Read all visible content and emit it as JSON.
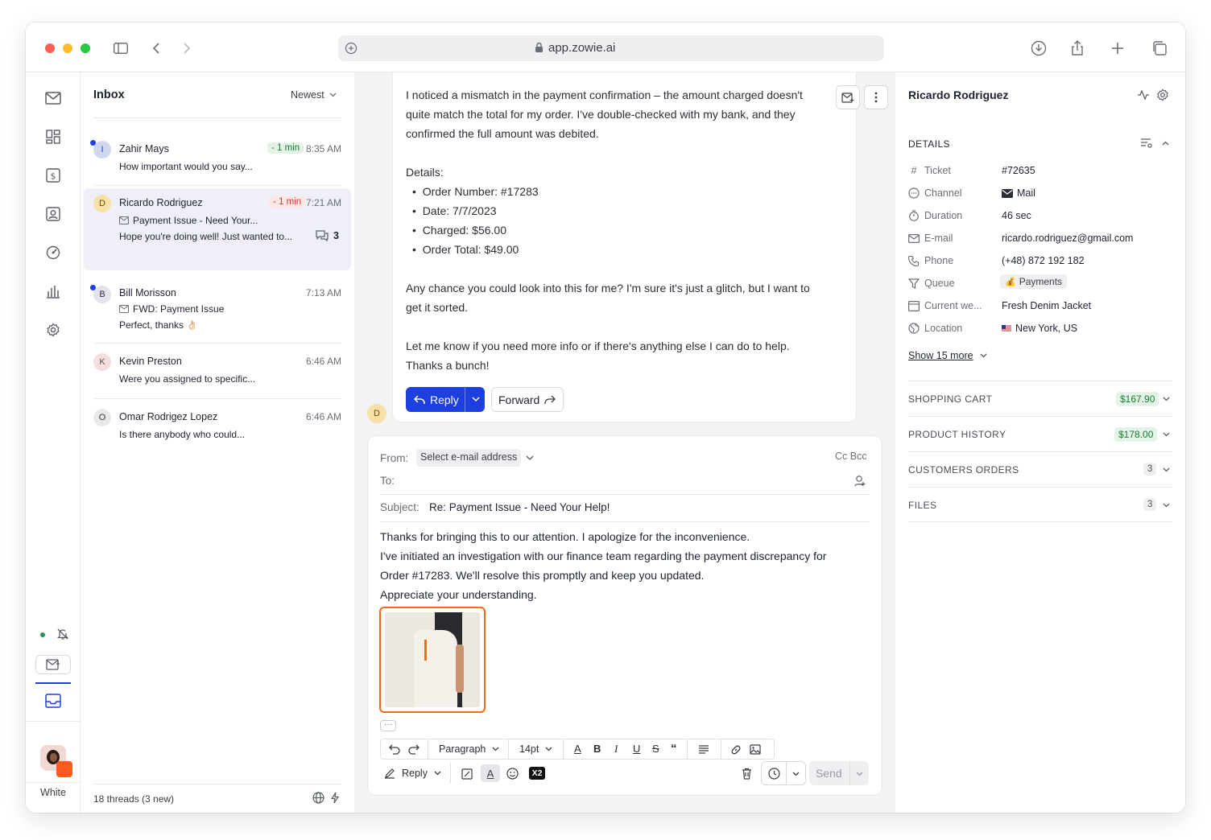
{
  "browser": {
    "url": "app.zowie.ai"
  },
  "inbox": {
    "title": "Inbox",
    "sort_label": "Newest",
    "threads": [
      {
        "initial": "I",
        "name": "Zahir Mays",
        "badge": "- 1 min",
        "time": "8:35 AM",
        "preview": "How important would you say...",
        "unread": true
      },
      {
        "initial": "D",
        "name": "Ricardo Rodriguez",
        "badge": "- 1 min",
        "time": "7:21 AM",
        "subject": "Payment Issue - Need Your...",
        "preview": "Hope you're doing well! Just wanted to...",
        "count": "3",
        "selected": true
      },
      {
        "initial": "B",
        "name": "Bill Morisson",
        "time": "7:13 AM",
        "subject": "FWD: Payment Issue",
        "preview": "Perfect, thanks 👌🏻",
        "unread": true
      },
      {
        "initial": "K",
        "name": "Kevin Preston",
        "time": "6:46 AM",
        "preview": "Were you assigned to specific..."
      },
      {
        "initial": "O",
        "name": "Omar Rodrigez Lopez",
        "time": "6:46 AM",
        "preview": "Is there anybody who could..."
      }
    ],
    "footer": "18 threads (3 new)"
  },
  "rail": {
    "user_label": "White"
  },
  "message": {
    "para1": [
      "I noticed a mismatch in the payment confirmation – the amount charged doesn't",
      "quite match the total for my order. I've double-checked with my bank, and they",
      "confirmed the full amount was debited."
    ],
    "details_label": "Details:",
    "details": [
      "Order Number: #17283",
      "Date: 7/7/2023",
      "Charged: $56.00",
      "Order Total: $49.00"
    ],
    "para2": [
      "Any chance you could look into this for me? I'm sure it's just a glitch, but I want to",
      "get it sorted."
    ],
    "para3": [
      "Let me know if you need more info or if there's anything else I can do to help.",
      "Thanks a bunch!"
    ],
    "reply_label": "Reply",
    "forward_label": "Forward",
    "sender_initial": "D"
  },
  "compose": {
    "from_label": "From:",
    "from_value": "Select e-mail address",
    "cc_bcc": "Cc Bcc",
    "to_label": "To:",
    "subject_label": "Subject:",
    "subject_value": "Re: Payment Issue - Need Your Help!",
    "body": [
      "Thanks for bringing this to our attention. I apologize for the inconvenience.",
      "I've initiated an investigation with our finance team regarding the payment discrepancy for",
      "Order #17283. We'll resolve this promptly and keep you updated.",
      "Appreciate your understanding."
    ],
    "toolbar": {
      "paragraph": "Paragraph",
      "size": "14pt"
    },
    "reply_mode": "Reply",
    "x2": "X2",
    "send_label": "Send"
  },
  "customer": {
    "name": "Ricardo Rodriguez",
    "details_title": "DETAILS",
    "fields": [
      {
        "icon": "hash-icon",
        "label": "Ticket",
        "value": "#72635"
      },
      {
        "icon": "chat-icon",
        "label": "Channel",
        "value": "Mail"
      },
      {
        "icon": "timer-icon",
        "label": "Duration",
        "value": "46 sec"
      },
      {
        "icon": "mail-icon",
        "label": "E-mail",
        "value": "ricardo.rodriguez@gmail.com"
      },
      {
        "icon": "phone-icon",
        "label": "Phone",
        "value": "(+48) 872 192 182"
      },
      {
        "icon": "filter-icon",
        "label": "Queue",
        "value": "Payments"
      },
      {
        "icon": "browser-icon",
        "label": "Current we...",
        "value": "Fresh Denim Jacket"
      },
      {
        "icon": "globe-icon",
        "label": "Location",
        "value": "New York, US"
      }
    ],
    "show_more": "Show 15 more",
    "sections": [
      {
        "title": "SHOPPING CART",
        "badge": "$167.90",
        "kind": "money"
      },
      {
        "title": "PRODUCT HISTORY",
        "badge": "$178.00",
        "kind": "money"
      },
      {
        "title": "CUSTOMERS ORDERS",
        "badge": "3",
        "kind": "count"
      },
      {
        "title": "FILES",
        "badge": "3",
        "kind": "count"
      }
    ]
  },
  "colors": {
    "accent": "#1d3fe0",
    "attachment_border": "#f26a1b",
    "green": "#1a7a36",
    "red": "#d63a2f"
  }
}
